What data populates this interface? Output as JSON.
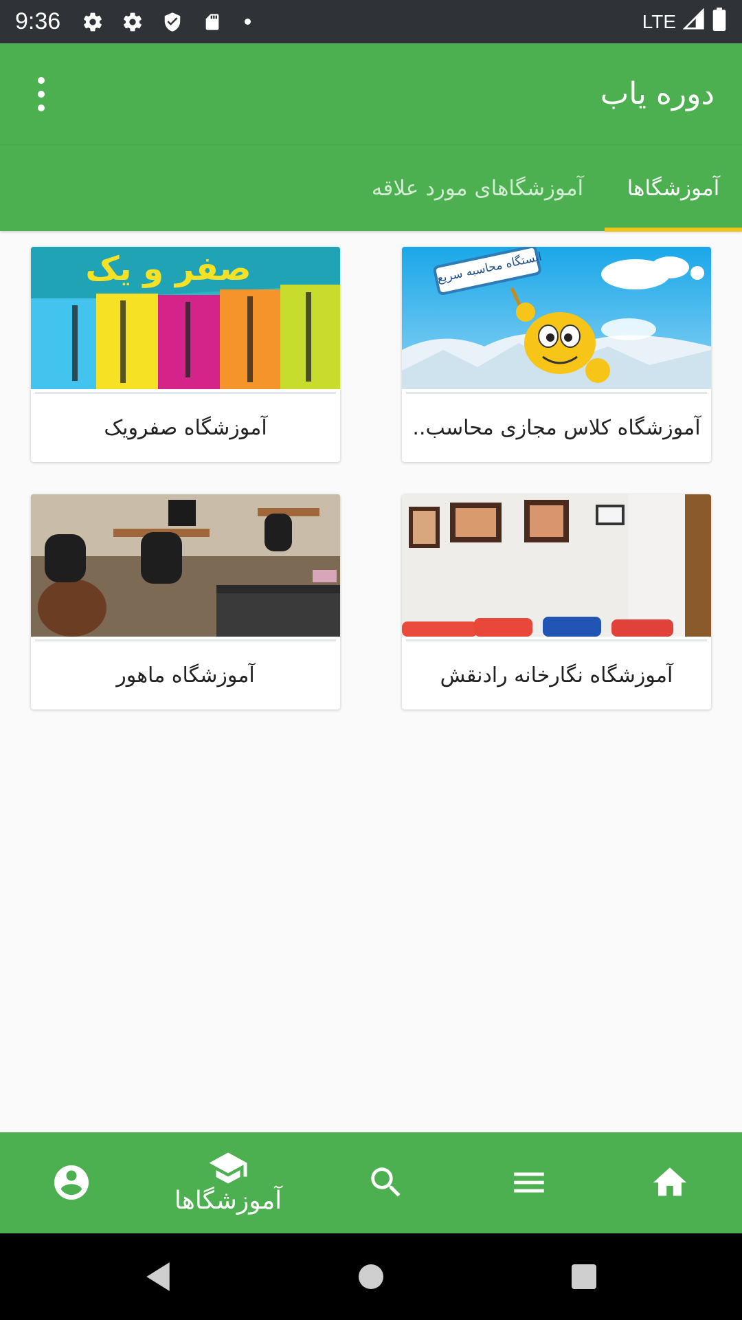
{
  "status_bar": {
    "time": "9:36",
    "network": "LTE",
    "icons": [
      "gear-icon",
      "gear-icon",
      "shield-icon",
      "sd-card-icon",
      "dot-icon",
      "signal-icon",
      "battery-icon"
    ]
  },
  "app_bar": {
    "title": "دوره یاب",
    "menu_icon": "overflow-menu-icon"
  },
  "tabs": [
    {
      "label": "آموزشگاها",
      "active": true
    },
    {
      "label": "آموزشگاهای مورد علاقه",
      "active": false
    }
  ],
  "cards": [
    {
      "label": "آموزشگاه کلاس مجازی محاسب..",
      "image_text": "ایستگاه محاسبه سریع"
    },
    {
      "label": "آموزشگاه صفرویک",
      "image_text": "صفر و یک"
    },
    {
      "label": "آموزشگاه نگارخانه رادنقش",
      "image_text": ""
    },
    {
      "label": "آموزشگاه ماهور",
      "image_text": ""
    }
  ],
  "bottom_nav": {
    "items": [
      {
        "icon": "home-icon",
        "label": ""
      },
      {
        "icon": "menu-icon",
        "label": ""
      },
      {
        "icon": "search-icon",
        "label": ""
      },
      {
        "icon": "school-icon",
        "label": "آموزشگاها",
        "active": true
      },
      {
        "icon": "account-icon",
        "label": ""
      }
    ]
  },
  "colors": {
    "primary": "#4caf50",
    "tab_indicator": "#f2c318",
    "status_bar": "#2f3337"
  }
}
